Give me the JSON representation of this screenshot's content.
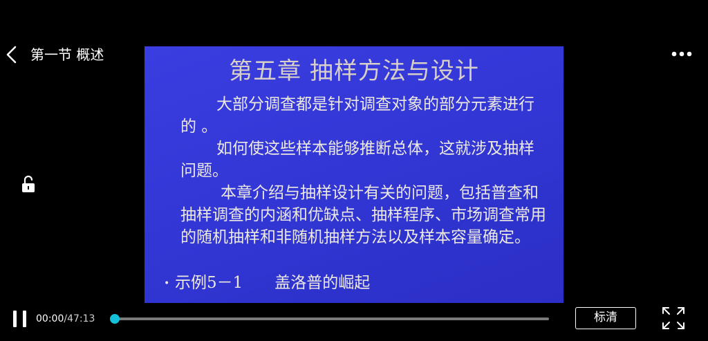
{
  "header": {
    "back_icon": "chevron-left-icon",
    "title": "第一节 概述",
    "more_icon": "more-horizontal-icon"
  },
  "side": {
    "lock_icon": "unlock-icon"
  },
  "slide": {
    "title": "第五章 抽样方法与设计",
    "paragraphs": [
      "大部分调查都是针对调查对象的部分元素进行的 。",
      "如何使这些样本能够推断总体，这就涉及抽样问题。",
      "本章介绍与抽样设计有关的问题，包括普查和抽样调查的内涵和优缺点、抽样程序、市场调查常用的随机抽样和非随机抽样方法以及样本容量确定。"
    ],
    "bullet_marker": "•",
    "bullet_label": "示例5－1",
    "bullet_text": "盖洛普的崛起"
  },
  "controls": {
    "pause_icon": "pause-icon",
    "current_time": "00:00",
    "total_time": "/47:13",
    "progress_fraction": 0.0,
    "progress_color": "#13c2d8",
    "quality_label": "标清",
    "fullscreen_icon": "fullscreen-icon"
  }
}
